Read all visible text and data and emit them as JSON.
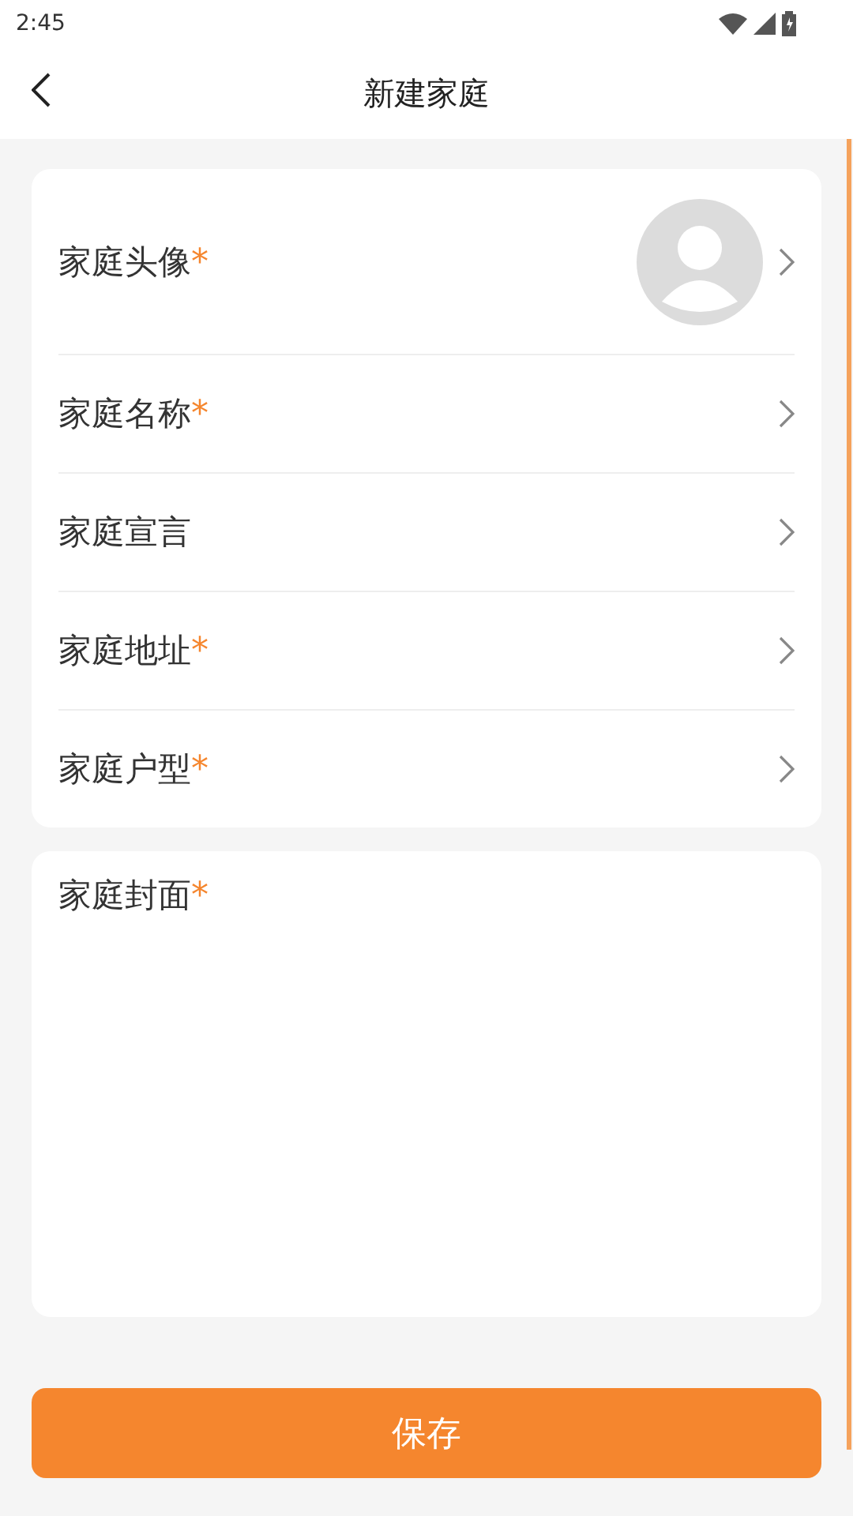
{
  "status_bar": {
    "time": "2:45"
  },
  "header": {
    "title": "新建家庭"
  },
  "fields": [
    {
      "kind": "avatar",
      "label": "家庭头像",
      "mark": "*"
    },
    {
      "kind": "link",
      "label": "家庭名称",
      "mark": "*"
    },
    {
      "kind": "link",
      "label": "家庭宣言"
    },
    {
      "kind": "link",
      "label": "家庭地址",
      "mark": "*"
    },
    {
      "kind": "link",
      "label": "家庭户型",
      "mark": "*"
    }
  ],
  "cover": {
    "label": "家庭封面",
    "mark": "*"
  },
  "save_button": "保存"
}
